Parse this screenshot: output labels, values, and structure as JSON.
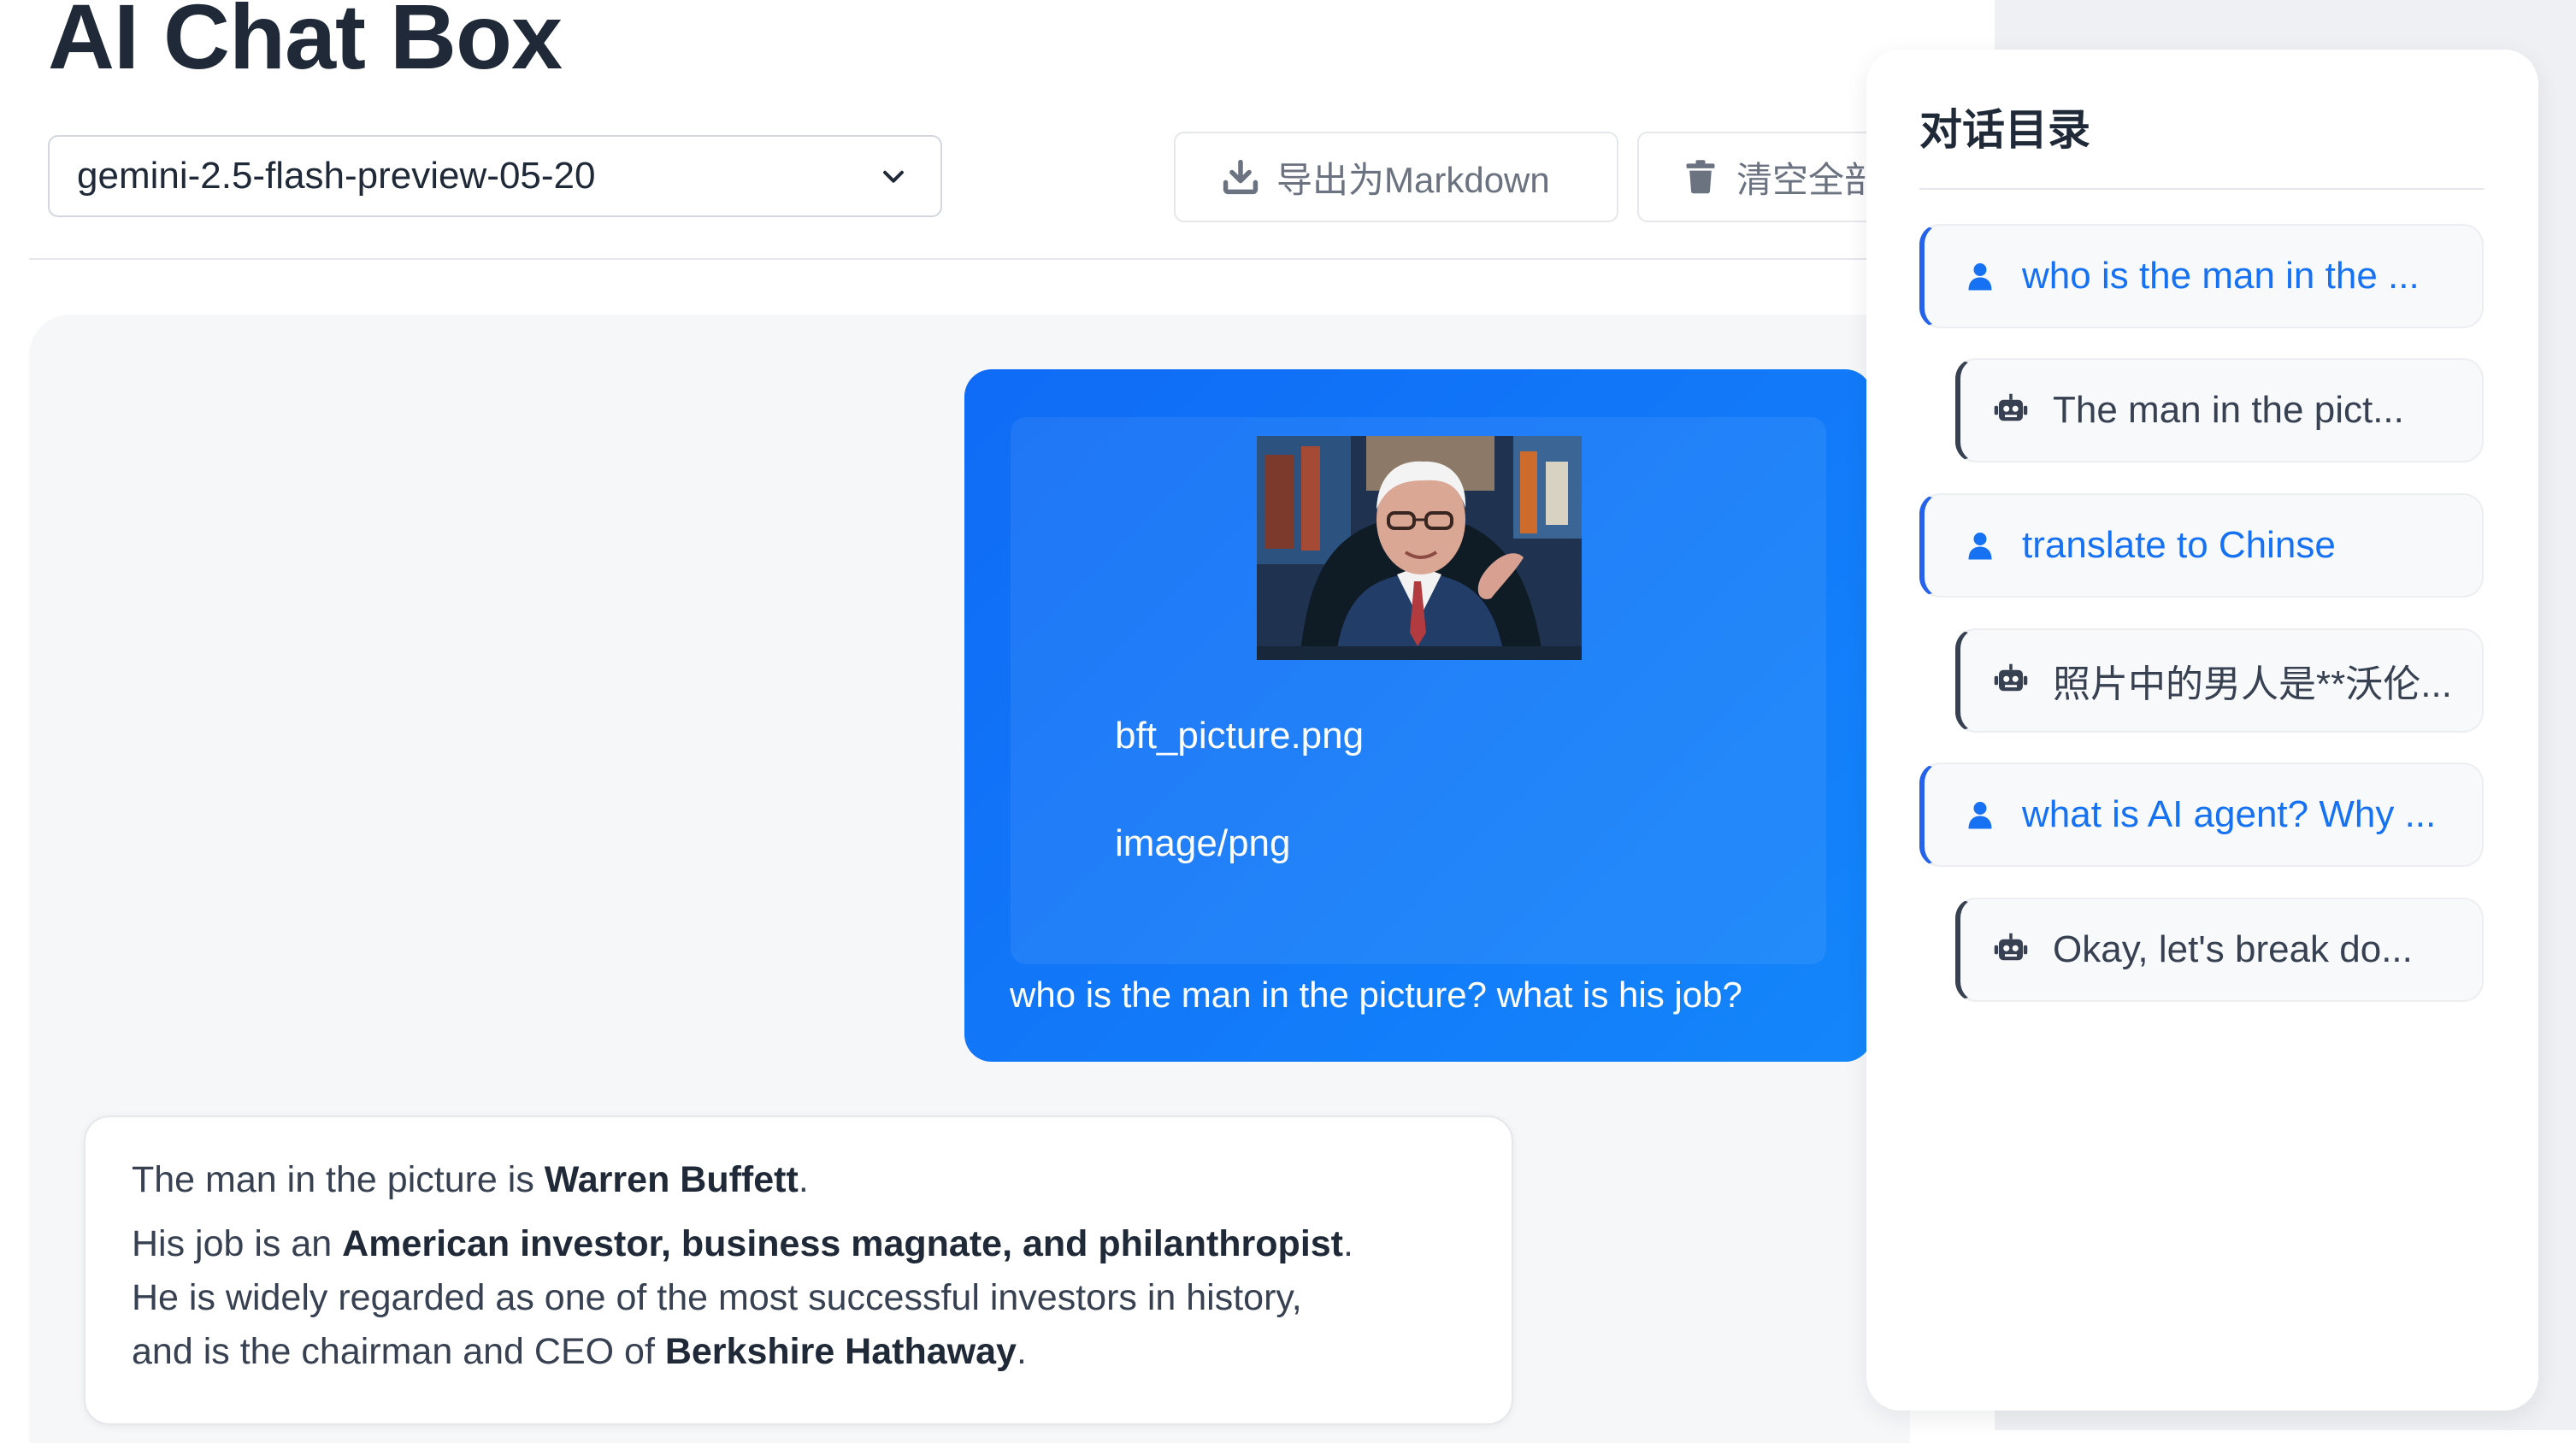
{
  "app": {
    "title": "AI Chat Box"
  },
  "toolbar": {
    "model": {
      "selected": "gemini-2.5-flash-preview-05-20"
    },
    "export_label": "导出为Markdown",
    "clear_label": "清空全部"
  },
  "chat": {
    "user_message": {
      "attachment": {
        "file_name": "bft_picture.png",
        "file_type": "image/png"
      },
      "text": "who is the man in the picture? what is his job?"
    },
    "assistant_message": {
      "line1_prefix": "The man in the picture is ",
      "line1_name": "Warren Buffett",
      "line1_suffix": ".",
      "line2_prefix": "His job is an ",
      "line2_bold": "American investor, business magnate, and philanthropist",
      "line2_suffix": ".",
      "line3": "He is widely regarded as one of the most successful investors in history,",
      "line4_prefix": "and is the chairman and CEO of ",
      "line4_bold": "Berkshire Hathaway",
      "line4_suffix": "."
    }
  },
  "toc": {
    "title": "对话目录",
    "items": [
      {
        "role": "user",
        "label": "who is the man in the ..."
      },
      {
        "role": "assistant",
        "label": "The man in the pict..."
      },
      {
        "role": "user",
        "label": "translate to Chinse"
      },
      {
        "role": "assistant",
        "label": "照片中的男人是**沃伦..."
      },
      {
        "role": "user",
        "label": "what is AI agent? Why ..."
      },
      {
        "role": "assistant",
        "label": "Okay, let's break do..."
      }
    ]
  },
  "icons": {
    "model_dropdown": "chevron-down-icon",
    "export": "download-icon",
    "clear": "trash-icon",
    "toc_user": "user-icon",
    "toc_assistant": "robot-icon"
  },
  "colors": {
    "accent": "#1672f3",
    "user_bubble": "#1279f8",
    "text_dark": "#1f2937",
    "muted": "#6b7280"
  }
}
